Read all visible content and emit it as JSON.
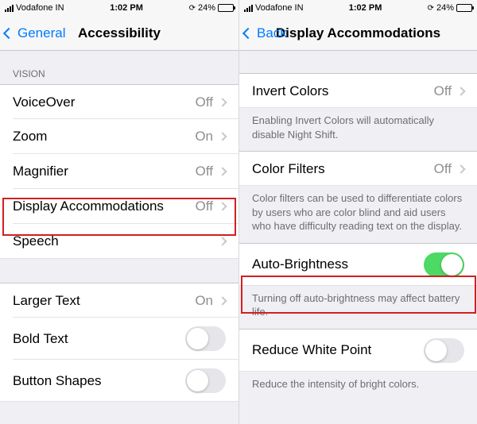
{
  "status": {
    "carrier": "Vodafone IN",
    "time": "1:02 PM",
    "battery_pct": "24%"
  },
  "left": {
    "back_label": "General",
    "title": "Accessibility",
    "vision_header": "VISION",
    "rows": {
      "voiceover": {
        "label": "VoiceOver",
        "value": "Off"
      },
      "zoom": {
        "label": "Zoom",
        "value": "On"
      },
      "magnifier": {
        "label": "Magnifier",
        "value": "Off"
      },
      "display_accom": {
        "label": "Display Accommodations",
        "value": "Off"
      },
      "speech": {
        "label": "Speech",
        "value": ""
      },
      "larger_text": {
        "label": "Larger Text",
        "value": "On"
      },
      "bold_text": {
        "label": "Bold Text",
        "on": false
      },
      "button_shapes": {
        "label": "Button Shapes",
        "on": false
      }
    }
  },
  "right": {
    "back_label": "Back",
    "title": "Display Accommodations",
    "rows": {
      "invert": {
        "label": "Invert Colors",
        "value": "Off"
      },
      "invert_footer": "Enabling Invert Colors will automatically disable Night Shift.",
      "color_filters": {
        "label": "Color Filters",
        "value": "Off"
      },
      "color_filters_footer": "Color filters can be used to differentiate colors by users who are color blind and aid users who have difficulty reading text on the display.",
      "auto_brightness": {
        "label": "Auto-Brightness",
        "on": true
      },
      "auto_brightness_footer": "Turning off auto-brightness may affect battery life.",
      "reduce_white": {
        "label": "Reduce White Point",
        "on": false
      },
      "reduce_white_footer": "Reduce the intensity of bright colors."
    }
  }
}
